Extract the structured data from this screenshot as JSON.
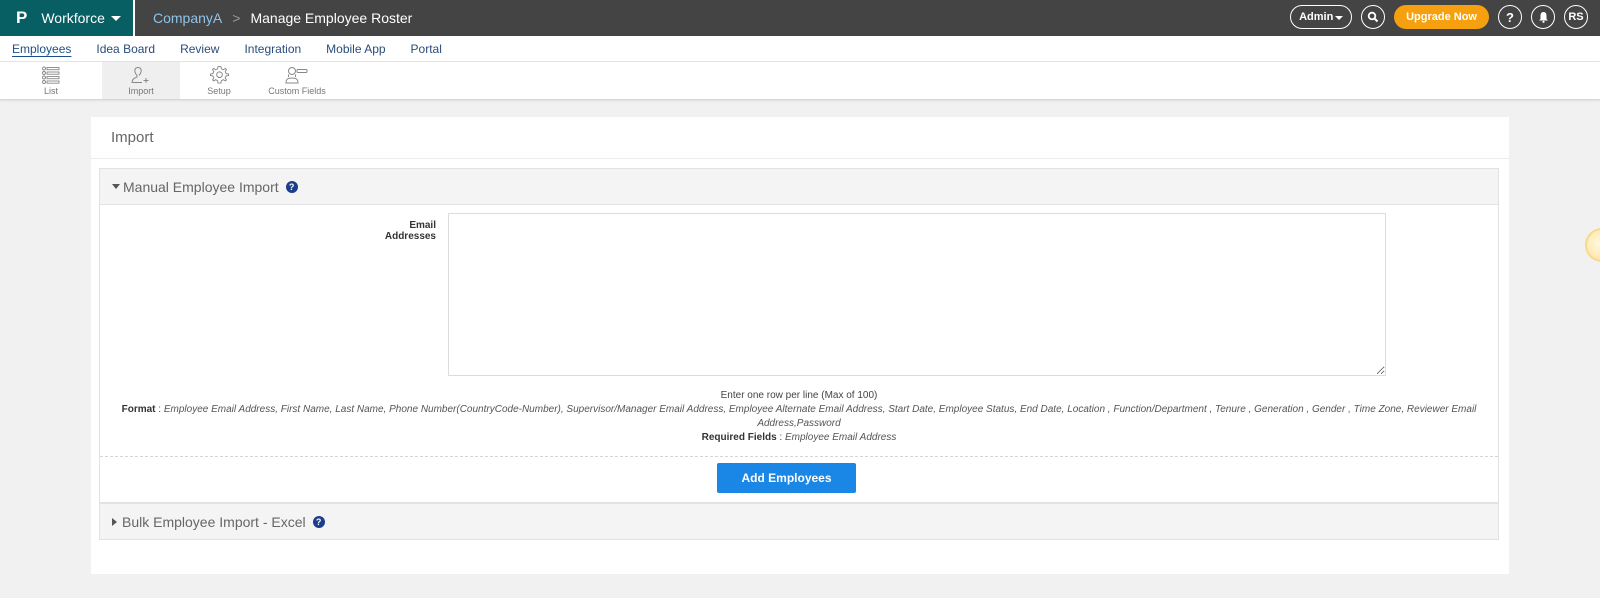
{
  "topbar": {
    "logo": "P",
    "app_name": "Workforce",
    "breadcrumb": {
      "company": "CompanyA",
      "separator": ">",
      "page_title": "Manage Employee Roster"
    },
    "role_selector": "Admin",
    "upgrade_label": "Upgrade Now",
    "help_label": "?",
    "avatar_initials": "RS",
    "colors": {
      "brand": "#075e63",
      "bar": "#444444",
      "upgrade": "#f6a00f"
    }
  },
  "menu": {
    "items": [
      {
        "label": "Employees",
        "active": true
      },
      {
        "label": "Idea Board"
      },
      {
        "label": "Review"
      },
      {
        "label": "Integration"
      },
      {
        "label": "Mobile App"
      },
      {
        "label": "Portal"
      }
    ]
  },
  "toolbar": {
    "tools": [
      {
        "label": "List",
        "icon": "list-icon"
      },
      {
        "label": "Import",
        "icon": "import-user-icon",
        "active": true
      },
      {
        "label": "Setup",
        "icon": "gear-icon"
      },
      {
        "label": "Custom Fields",
        "icon": "custom-fields-icon"
      }
    ]
  },
  "page": {
    "heading": "Import",
    "manual_import": {
      "title": "Manual Employee Import",
      "expanded": true,
      "email_label": "Email Addresses",
      "email_value": "",
      "hint": "Enter one row per line (Max of 100)",
      "format_label": "Format",
      "format_text": "Employee Email Address, First Name, Last Name, Phone Number(CountryCode-Number), Supervisor/Manager Email Address, Employee Alternate Email Address, Start Date, Employee Status, End Date, Location , Function/Department , Tenure , Generation , Gender , Time Zone, Reviewer Email Address,Password",
      "required_label": "Required Fields",
      "required_text": "Employee Email Address",
      "submit_label": "Add Employees",
      "help_icon": "?"
    },
    "bulk_import": {
      "title": "Bulk Employee Import - Excel",
      "expanded": false,
      "help_icon": "?"
    }
  }
}
